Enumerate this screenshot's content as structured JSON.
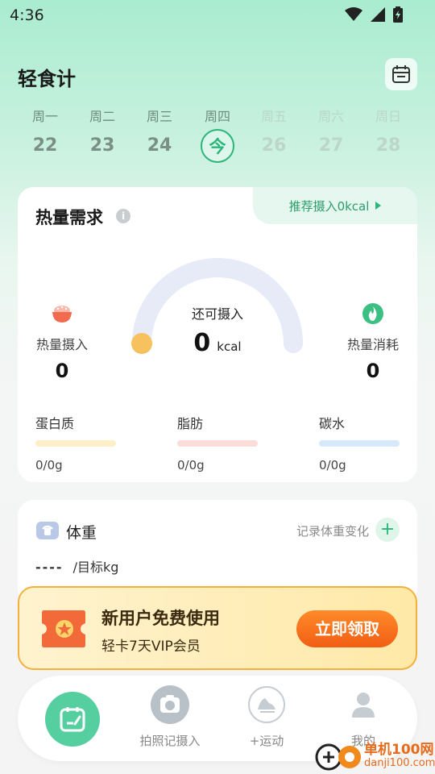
{
  "status": {
    "time": "4:36"
  },
  "app": {
    "title": "轻食计"
  },
  "week": [
    {
      "weekday": "周一",
      "date": "22",
      "state": "past"
    },
    {
      "weekday": "周二",
      "date": "23",
      "state": "past"
    },
    {
      "weekday": "周三",
      "date": "24",
      "state": "past"
    },
    {
      "weekday": "周四",
      "date": "今",
      "state": "today"
    },
    {
      "weekday": "周五",
      "date": "26",
      "state": "future"
    },
    {
      "weekday": "周六",
      "date": "27",
      "state": "future"
    },
    {
      "weekday": "周日",
      "date": "28",
      "state": "future"
    }
  ],
  "calorie_card": {
    "title": "热量需求",
    "info_icon": "i",
    "recommend": "推荐摄入0kcal",
    "remaining_label": "还可摄入",
    "remaining_value": "0",
    "remaining_unit": "kcal",
    "remaining_fraction": 0,
    "intake": {
      "label": "热量摄入",
      "value": "0"
    },
    "burned": {
      "label": "热量消耗",
      "value": "0"
    },
    "macros": [
      {
        "name": "蛋白质",
        "amount": "0/0g",
        "color": "#fcefc9"
      },
      {
        "name": "脂肪",
        "amount": "0/0g",
        "color": "#fadcd9"
      },
      {
        "name": "碳水",
        "amount": "0/0g",
        "color": "#d6e8fa"
      }
    ]
  },
  "weight_card": {
    "title": "体重",
    "record_label": "记录体重变化",
    "add_icon": "+",
    "value": "----",
    "target": "/目标kg"
  },
  "promo": {
    "title": "新用户免费使用",
    "subtitle": "轻卡7天VIP会员",
    "button": "立即领取"
  },
  "nav": {
    "photo_label": "拍照记摄入",
    "exercise_label": "+运动",
    "mine_label": "我的"
  },
  "watermark": {
    "line1": "单机100网",
    "line2": "danji100.com"
  },
  "colors": {
    "accent": "#2bb57a",
    "gauge_track": "#e6ebf7",
    "gauge_knob": "#f7c15d",
    "promo_btn": "#f25e13"
  }
}
